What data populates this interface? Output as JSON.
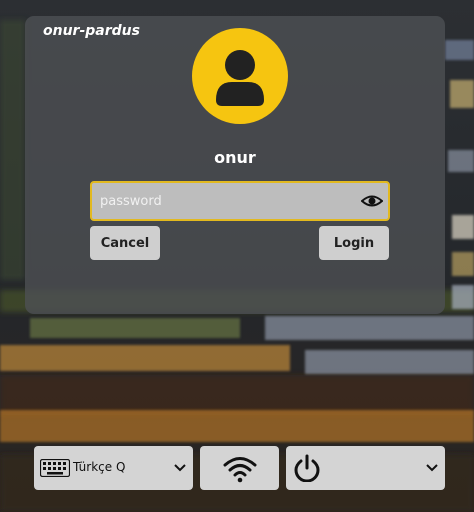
{
  "session": {
    "hostname": "onur-pardus",
    "username": "onur"
  },
  "password": {
    "value": "",
    "placeholder": "password"
  },
  "buttons": {
    "cancel": "Cancel",
    "login": "Login"
  },
  "bottom_bar": {
    "keyboard_layout": "Türkçe Q"
  },
  "icons": {
    "avatar": "user-avatar-icon",
    "visibility": "eye-icon",
    "keyboard": "keyboard-icon",
    "network": "wifi-icon",
    "power": "power-icon",
    "dropdown": "chevron-down-icon"
  },
  "colors": {
    "accent": "#f6c510",
    "field_border": "#e2b91f",
    "panel": "#4e5054",
    "button": "#cfcfcf"
  }
}
